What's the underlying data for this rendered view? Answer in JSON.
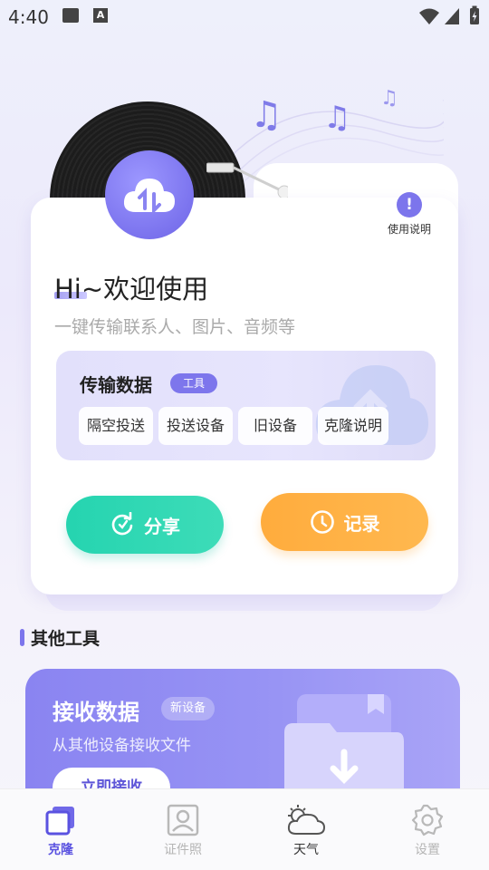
{
  "status_bar": {
    "time": "4:40"
  },
  "help": {
    "label": "使用说明",
    "icon": "!"
  },
  "greeting": {
    "title": "Hi~欢迎使用",
    "subtitle": "一键传输联系人、图片、音频等"
  },
  "transfer": {
    "title": "传输数据",
    "tag": "工具",
    "chips": [
      "隔空投送",
      "投送设备",
      "旧设备",
      "克隆说明"
    ]
  },
  "actions": {
    "share_label": "分享",
    "record_label": "记录"
  },
  "colors": {
    "accent": "#7c75ec",
    "share": "#2bd6b2",
    "record": "#ffb043"
  },
  "other_tools": {
    "section_title": "其他工具",
    "receive": {
      "title": "接收数据",
      "tag": "新设备",
      "subtitle": "从其他设备接收文件",
      "button": "立即接收"
    }
  },
  "bottom_nav": {
    "items": [
      {
        "label": "克隆",
        "icon": "clone-icon",
        "active": true
      },
      {
        "label": "证件照",
        "icon": "id-photo-icon",
        "active": false
      },
      {
        "label": "天气",
        "icon": "weather-icon",
        "active": false
      },
      {
        "label": "设置",
        "icon": "settings-icon",
        "active": false
      }
    ]
  }
}
